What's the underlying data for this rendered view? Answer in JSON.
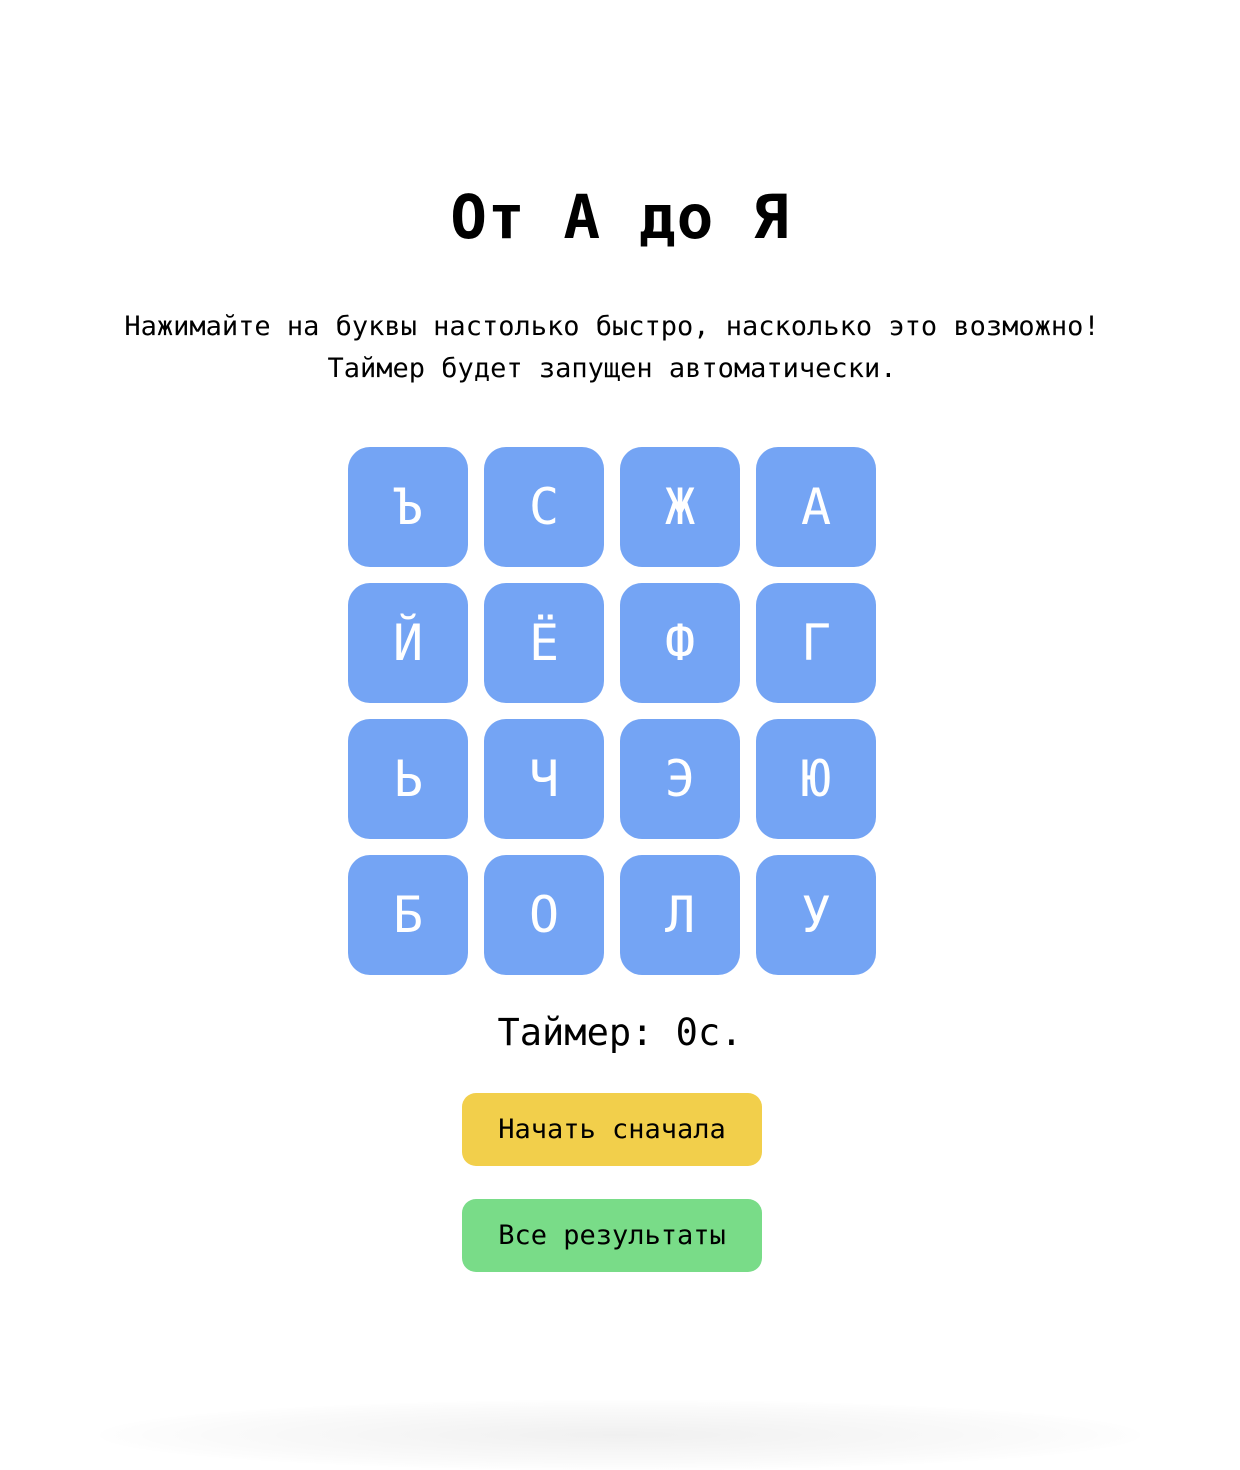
{
  "title": "От А до Я",
  "instructions": {
    "line1": "Нажимайте на буквы настолько быстро, насколько это возможно!",
    "line2": "Таймер будет запущен автоматически."
  },
  "tiles": [
    "Ъ",
    "С",
    "Ж",
    "А",
    "Й",
    "Ё",
    "Ф",
    "Г",
    "Ь",
    "Ч",
    "Э",
    "Ю",
    "Б",
    "О",
    "Л",
    "У"
  ],
  "timer": {
    "text": "Таймер: 0с."
  },
  "buttons": {
    "restart": "Начать сначала",
    "results": "Все результаты"
  },
  "colors": {
    "tile": "#74a4f4",
    "restart": "#f2cf4b",
    "results": "#79dc88"
  }
}
